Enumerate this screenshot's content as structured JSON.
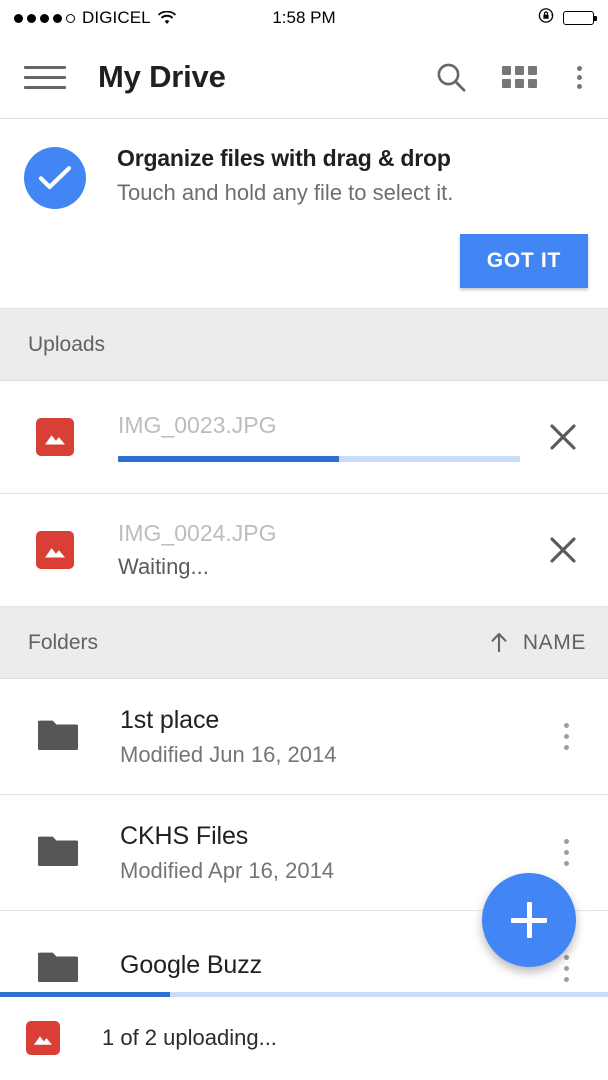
{
  "status_bar": {
    "signal_dots_filled": 4,
    "signal_dots_total": 5,
    "carrier": "DIGICEL",
    "wifi_icon": "wifi-icon",
    "time": "1:58 PM",
    "rotation_lock_icon": "rotation-lock-icon",
    "battery_icon": "battery-full-icon",
    "battery_level_percent": 100
  },
  "app_bar": {
    "menu_icon": "hamburger-menu-icon",
    "title": "My Drive",
    "search_icon": "search-icon",
    "grid_view_icon": "grid-view-icon",
    "overflow_icon": "more-vertical-icon"
  },
  "promo": {
    "check_icon": "check-circle-icon",
    "title": "Organize files with drag & drop",
    "subtitle": "Touch and hold any file to select it.",
    "dismiss_label": "GOT IT",
    "accent_color": "#4285f4"
  },
  "uploads_section": {
    "header_label": "Uploads",
    "items": [
      {
        "file_icon": "image-file-icon",
        "name": "IMG_0023.JPG",
        "progress_percent": 55,
        "status": "",
        "cancel_icon": "close-icon"
      },
      {
        "file_icon": "image-file-icon",
        "name": "IMG_0024.JPG",
        "progress_percent": null,
        "status": "Waiting...",
        "cancel_icon": "close-icon"
      }
    ]
  },
  "folders_section": {
    "header_label": "Folders",
    "sort_arrow_icon": "arrow-up-icon",
    "sort_label": "NAME",
    "items": [
      {
        "folder_icon": "folder-icon",
        "name": "1st place",
        "meta": "Modified Jun 16, 2014",
        "overflow_icon": "more-vertical-icon"
      },
      {
        "folder_icon": "folder-icon",
        "name": "CKHS Files",
        "meta": "Modified Apr 16, 2014",
        "overflow_icon": "more-vertical-icon"
      },
      {
        "folder_icon": "folder-icon",
        "name": "Google Buzz",
        "meta": "",
        "overflow_icon": "more-vertical-icon"
      }
    ]
  },
  "fab": {
    "icon": "plus-icon",
    "color": "#4285f4"
  },
  "bottom_bar": {
    "file_icon": "image-file-icon",
    "text": "1 of 2 uploading...",
    "progress_percent": 28
  }
}
